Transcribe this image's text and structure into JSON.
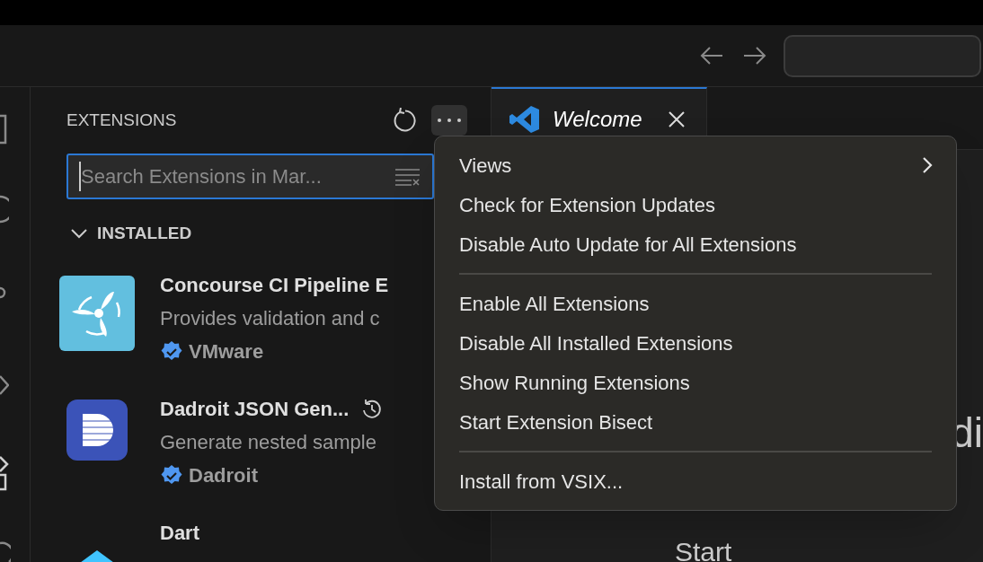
{
  "sidebar": {
    "title": "EXTENSIONS",
    "search": {
      "placeholder": "Search Extensions in Mar...",
      "focused": true
    },
    "section": {
      "title": "INSTALLED",
      "expanded": true
    },
    "extensions": [
      {
        "name": "Concourse CI Pipeline E",
        "description": "Provides validation and c",
        "publisher": "VMware",
        "verified": true,
        "kind": "concourse"
      },
      {
        "name": "Dadroit JSON Gen...",
        "description": "Generate nested sample",
        "publisher": "Dadroit",
        "verified": true,
        "kind": "dadroit",
        "history": true
      },
      {
        "name": "Dart",
        "kind": "dart"
      }
    ]
  },
  "tabs": [
    {
      "label": "Welcome",
      "selected": true
    }
  ],
  "menu": {
    "groups": [
      [
        {
          "label": "Views",
          "submenu": true
        },
        {
          "label": "Check for Extension Updates"
        },
        {
          "label": "Disable Auto Update for All Extensions"
        }
      ],
      [
        {
          "label": "Enable All Extensions"
        },
        {
          "label": "Disable All Installed Extensions"
        },
        {
          "label": "Show Running Extensions"
        },
        {
          "label": "Start Extension Bisect"
        }
      ],
      [
        {
          "label": "Install from VSIX..."
        }
      ]
    ]
  },
  "editor": {
    "heading": "di",
    "section": "Start"
  }
}
